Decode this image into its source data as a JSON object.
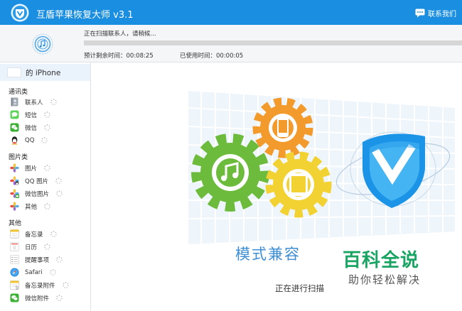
{
  "titlebar": {
    "title": "互盾苹果恢复大师 v3.1",
    "contact_label": "联系我们",
    "color": "#1a8ee0"
  },
  "progress": {
    "status": "正在扫描联系人，请稍候...",
    "fraction": 0.0,
    "time_remaining": "预计剩余时间：00:08:25",
    "time_used": "已使用时间：00:00:05"
  },
  "sidebar": {
    "device_name": "的 iPhone",
    "groups": [
      {
        "label": "通讯类",
        "items": [
          {
            "label": "联系人",
            "icon": "contacts-icon"
          },
          {
            "label": "短信",
            "icon": "messages-icon"
          },
          {
            "label": "微信",
            "icon": "wechat-icon"
          },
          {
            "label": "QQ",
            "icon": "qq-icon"
          }
        ]
      },
      {
        "label": "图片类",
        "items": [
          {
            "label": "图片",
            "icon": "photos-icon"
          },
          {
            "label": "QQ 图片",
            "icon": "qq-photos-icon"
          },
          {
            "label": "微信图片",
            "icon": "wechat-photos-icon"
          },
          {
            "label": "其他",
            "icon": "other-photos-icon"
          }
        ]
      },
      {
        "label": "其他",
        "items": [
          {
            "label": "备忘录",
            "icon": "notes-icon"
          },
          {
            "label": "日历",
            "icon": "calendar-icon"
          },
          {
            "label": "提醒事项",
            "icon": "reminders-icon"
          },
          {
            "label": "Safari",
            "icon": "safari-icon"
          },
          {
            "label": "备忘录附件",
            "icon": "notes-attachments-icon"
          },
          {
            "label": "微信附件",
            "icon": "wechat-attachments-icon"
          }
        ]
      }
    ]
  },
  "main": {
    "mode_title": "模式兼容",
    "scanning_text": "正在进行扫描"
  },
  "watermark": {
    "title": "百科全说",
    "subtitle": "助你轻松解决"
  }
}
